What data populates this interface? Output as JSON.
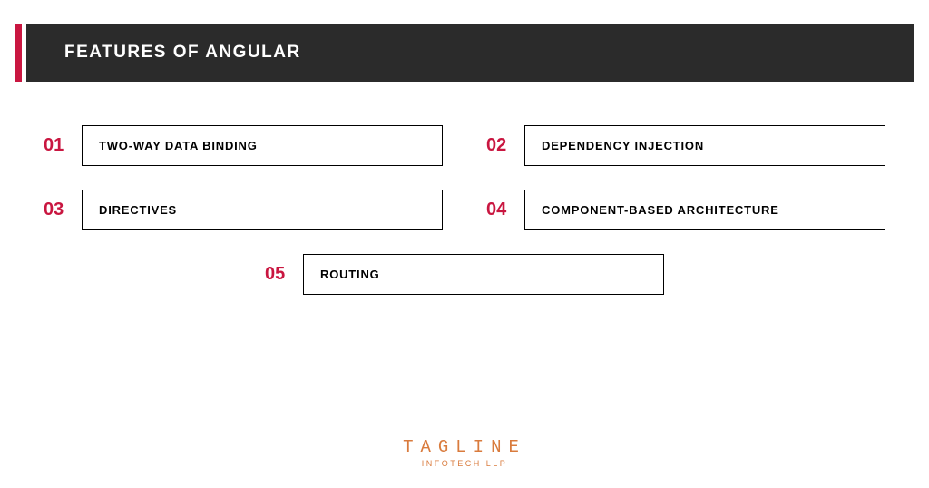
{
  "header": {
    "title": "FEATURES OF ANGULAR"
  },
  "features": [
    {
      "number": "01",
      "label": "TWO-WAY DATA BINDING"
    },
    {
      "number": "02",
      "label": "DEPENDENCY INJECTION"
    },
    {
      "number": "03",
      "label": "DIRECTIVES"
    },
    {
      "number": "04",
      "label": "COMPONENT-BASED ARCHITECTURE"
    },
    {
      "number": "05",
      "label": "ROUTING"
    }
  ],
  "logo": {
    "main": "TAGLINE",
    "sub": "INFOTECH LLP"
  },
  "colors": {
    "accent": "#c91640",
    "headerBg": "#2b2b2b",
    "logoColor": "#d97b3d"
  }
}
